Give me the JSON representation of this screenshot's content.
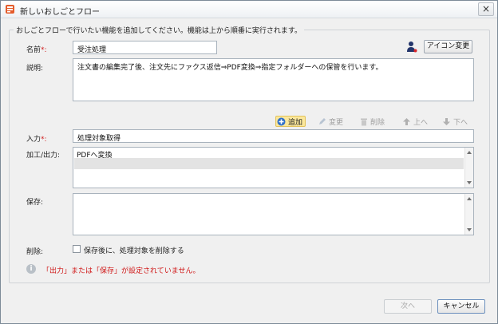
{
  "window": {
    "title": "新しいおしごとフロー",
    "close_symbol": "×"
  },
  "group": {
    "caption": "おしごとフローで行いたい機能を追加してください。機能は上から順番に実行されます。"
  },
  "fields": {
    "name_label": "名前",
    "name_required": "*:",
    "name_value": "受注処理",
    "icon_change_button": "アイコン変更",
    "description_label": "説明:",
    "description_value": "注文書の編集完了後、注文先にファクス返信⇒PDF変換⇒指定フォルダーへの保管を行います。",
    "input_label": "入力",
    "input_required": "*:",
    "input_value": "処理対象取得",
    "process_output_label": "加工/出力:",
    "process_items": [
      "PDFへ変換"
    ],
    "save_label": "保存:",
    "delete_label": "削除:",
    "delete_checkbox_label": "保存後に、処理対象を削除する",
    "delete_checked": false
  },
  "toolbar": {
    "add": "追加",
    "edit": "変更",
    "remove": "削除",
    "up": "上へ",
    "down": "下へ"
  },
  "warning": {
    "text": "「出力」または「保存」が設定されていません。"
  },
  "footer": {
    "next_button": "次へ",
    "cancel_button": "キャンセル"
  },
  "icons": {
    "app": "flow-app-icon",
    "user_icon": "user-figure-icon",
    "add": "plus-circle-icon",
    "edit": "pencil-icon",
    "remove": "trash-icon",
    "up": "arrow-up-icon",
    "down": "arrow-down-icon",
    "info": "info-icon"
  },
  "colors": {
    "add_highlight": "#fbe79b",
    "warning_text": "#d01818",
    "required_mark": "#d02020"
  }
}
